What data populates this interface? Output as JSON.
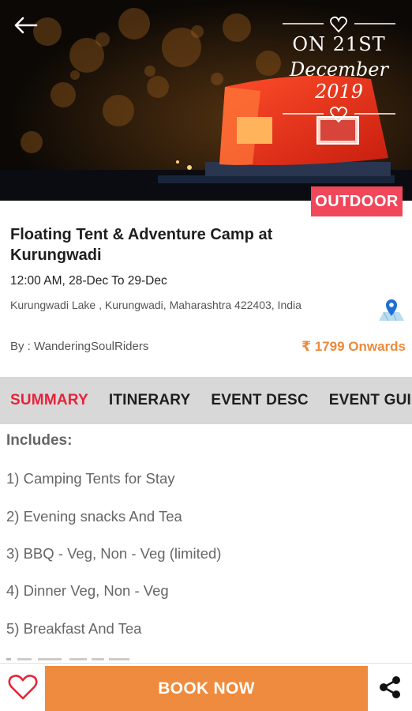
{
  "hero": {
    "overlay_line1": "ON 21ST",
    "overlay_line2": "December 2019",
    "category_badge": "OUTDOOR"
  },
  "event": {
    "title": "Floating Tent & Adventure Camp at Kurungwadi",
    "datetime": "12:00 AM, 28-Dec To 29-Dec",
    "address": "Kurungwadi Lake , Kurungwadi, Maharashtra 422403, India",
    "organizer": "By : WanderingSoulRiders",
    "price": "₹ 1799 Onwards"
  },
  "tabs": [
    {
      "label": "SUMMARY",
      "active": true
    },
    {
      "label": "ITINERARY",
      "active": false
    },
    {
      "label": "EVENT DESC",
      "active": false
    },
    {
      "label": "EVENT GUI",
      "active": false
    }
  ],
  "summary": {
    "heading": "Includes:",
    "items": [
      "1) Camping Tents for Stay",
      "2) Evening snacks And Tea",
      "3) BBQ - Veg, Non - Veg (limited)",
      "4) Dinner Veg, Non - Veg",
      "5) Breakfast And Tea"
    ]
  },
  "bottom_bar": {
    "book_label": "BOOK NOW"
  },
  "icons": {
    "back": "back-arrow-icon",
    "map": "map-pin-icon",
    "favorite": "heart-icon",
    "share": "share-icon"
  },
  "colors": {
    "accent_red": "#e8223a",
    "badge_pink": "#f0475b",
    "price_orange": "#ee8a3a",
    "book_orange": "#ef8b3e",
    "tabbar_gray": "#d8d8d8"
  }
}
